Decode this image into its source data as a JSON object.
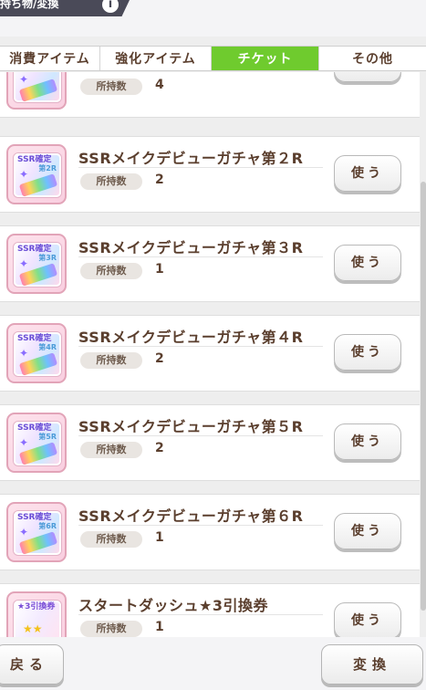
{
  "header": {
    "title": "持ち物/変換",
    "info_icon": "i"
  },
  "tabs": [
    {
      "label": "消費アイテム",
      "active": false
    },
    {
      "label": "強化アイテム",
      "active": false
    },
    {
      "label": "チケット",
      "active": true
    },
    {
      "label": "その他",
      "active": false
    }
  ],
  "owned_label": "所持数",
  "use_label": "使う",
  "items": [
    {
      "name": "",
      "count": "4",
      "ticket_top": "",
      "ticket_sub": ""
    },
    {
      "name": "SSRメイクデビューガチャ第２R",
      "count": "2",
      "ticket_top": "SSR確定",
      "ticket_sub": "第2R"
    },
    {
      "name": "SSRメイクデビューガチャ第３R",
      "count": "1",
      "ticket_top": "SSR確定",
      "ticket_sub": "第3R"
    },
    {
      "name": "SSRメイクデビューガチャ第４R",
      "count": "2",
      "ticket_top": "SSR確定",
      "ticket_sub": "第4R"
    },
    {
      "name": "SSRメイクデビューガチャ第５R",
      "count": "2",
      "ticket_top": "SSR確定",
      "ticket_sub": "第5R"
    },
    {
      "name": "SSRメイクデビューガチャ第６R",
      "count": "1",
      "ticket_top": "SSR確定",
      "ticket_sub": "第6R"
    },
    {
      "name": "スタートダッシュ★3引換券",
      "count": "1",
      "ticket_top": "★3引換券",
      "ticket_sub": ""
    }
  ],
  "footer": {
    "back_label": "戻る",
    "exchange_label": "変換"
  },
  "colors": {
    "active_tab": "#6fcb2e",
    "text": "#5b3f2e"
  }
}
